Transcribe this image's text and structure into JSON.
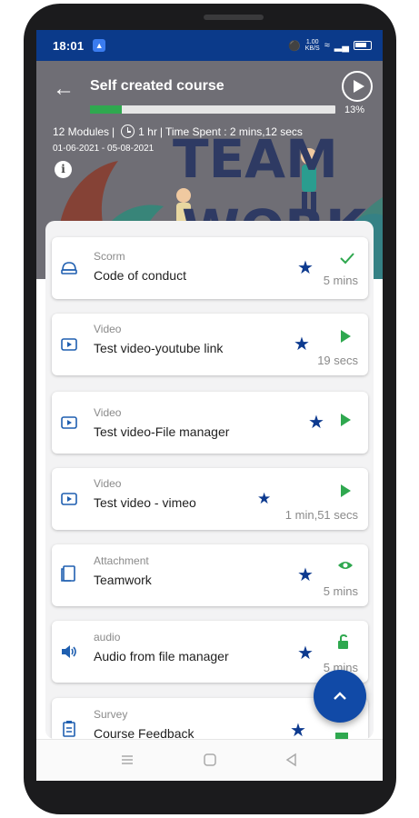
{
  "status_bar": {
    "time": "18:01",
    "net_speed_value": "1.00",
    "net_speed_unit": "KB/S"
  },
  "header": {
    "title": "Self created course",
    "progress_percent": 13,
    "progress_label": "13%",
    "modules": "12 Modules",
    "duration": "1 hr",
    "time_spent": "Time Spent : 2 mins,12 secs",
    "date_range": "01-06-2021 - 05-08-2021",
    "banner_text_line1": "TEAM",
    "banner_text_line2": "WORK"
  },
  "modules": [
    {
      "type": "Scorm",
      "name": "Code of conduct",
      "icon": "scorm-icon",
      "status_icon": "check-icon",
      "duration": "5 mins"
    },
    {
      "type": "Video",
      "name": "Test video-youtube link",
      "icon": "video-icon",
      "status_icon": "play-icon",
      "duration": "19 secs"
    },
    {
      "type": "Video",
      "name": "Test video-File manager",
      "icon": "video-icon",
      "status_icon": "play-icon",
      "duration": ""
    },
    {
      "type": "Video",
      "name": "Test video - vimeo",
      "icon": "video-icon",
      "status_icon": "play-icon",
      "duration": "1 min,51 secs"
    },
    {
      "type": "Attachment",
      "name": "Teamwork",
      "icon": "attachment-icon",
      "status_icon": "eye-icon",
      "duration": "5 mins"
    },
    {
      "type": "audio",
      "name": "Audio from file manager",
      "icon": "audio-icon",
      "status_icon": "unlock-icon",
      "duration": "5 mins"
    },
    {
      "type": "Survey",
      "name": "Course Feedback",
      "icon": "survey-icon",
      "status_icon": "status-icon",
      "duration": ""
    }
  ],
  "colors": {
    "status_bar": "#0b3a8a",
    "accent": "#114aa7",
    "star": "#0d3a8f",
    "status_green": "#2fa84f",
    "icon_blue": "#1f5fb0"
  }
}
